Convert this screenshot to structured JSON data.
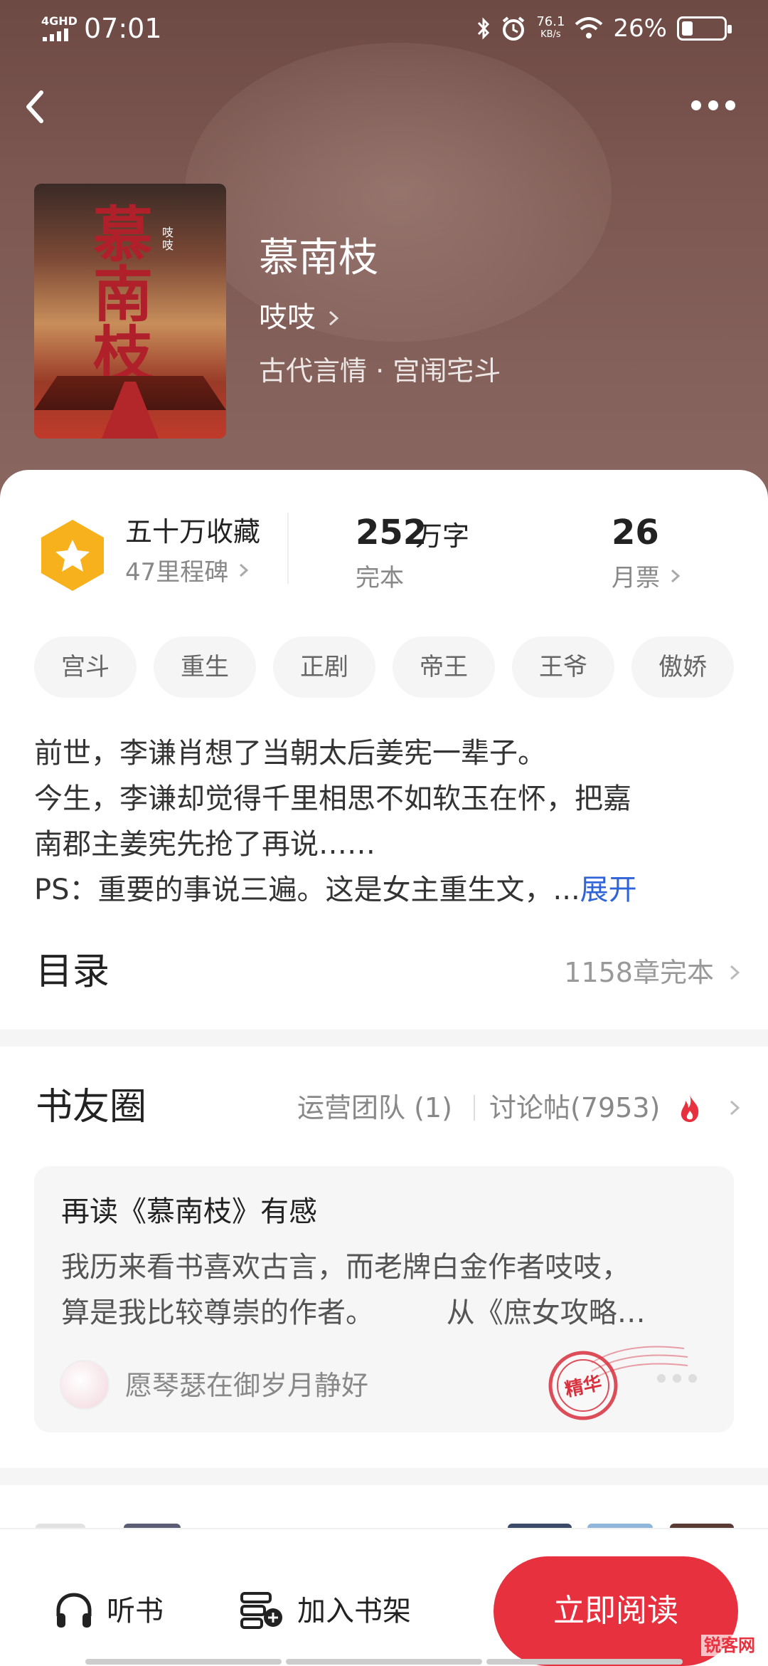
{
  "status_bar": {
    "network": "4GHD",
    "time": "07:01",
    "speed_value": "76.1",
    "speed_unit": "KB/s",
    "battery": "26%",
    "battery_level": 0.26
  },
  "book": {
    "title": "慕南枝",
    "author": "吱吱",
    "genre": "古代言情 · 宫闱宅斗",
    "cover_title": "慕南枝",
    "cover_subtitle": "吱吱"
  },
  "stats": {
    "collection": "五十万收藏",
    "milestone": "47里程碑",
    "word_count": "252",
    "word_unit": "万字",
    "status": "完本",
    "monthly_votes": "26",
    "monthly_label": "月票"
  },
  "tags": [
    "宫斗",
    "重生",
    "正剧",
    "帝王",
    "王爷",
    "傲娇"
  ],
  "synopsis": {
    "lines": [
      "前世，李谦肖想了当朝太后姜宪一辈子。",
      "今生，李谦却觉得千里相思不如软玉在怀，把嘉",
      "南郡主姜宪先抢了再说……",
      "PS：重要的事说三遍。这是女主重生文，..."
    ],
    "expand_label": "展开"
  },
  "toc": {
    "label": "目录",
    "meta": "1158章完本"
  },
  "book_circle": {
    "title": "书友圈",
    "team": "运营团队 (1)",
    "posts": "讨论帖(7953)",
    "post": {
      "title": "再读《慕南枝》有感",
      "body_lines": [
        "我历来看书喜欢古言，而老牌白金作者吱吱，",
        "算是我比较尊崇的作者。        从《庶女攻略…"
      ],
      "user": "愿琴瑟在御岁月静好",
      "stamp": "精华"
    }
  },
  "bottom_bar": {
    "listen": "听书",
    "add_shelf": "加入书架",
    "read_now": "立即阅读"
  },
  "watermark": "锐客网",
  "colors": {
    "accent": "#e8313f",
    "link": "#2f64d8",
    "badge": "#f7b11c",
    "hero": "#7c5650"
  }
}
